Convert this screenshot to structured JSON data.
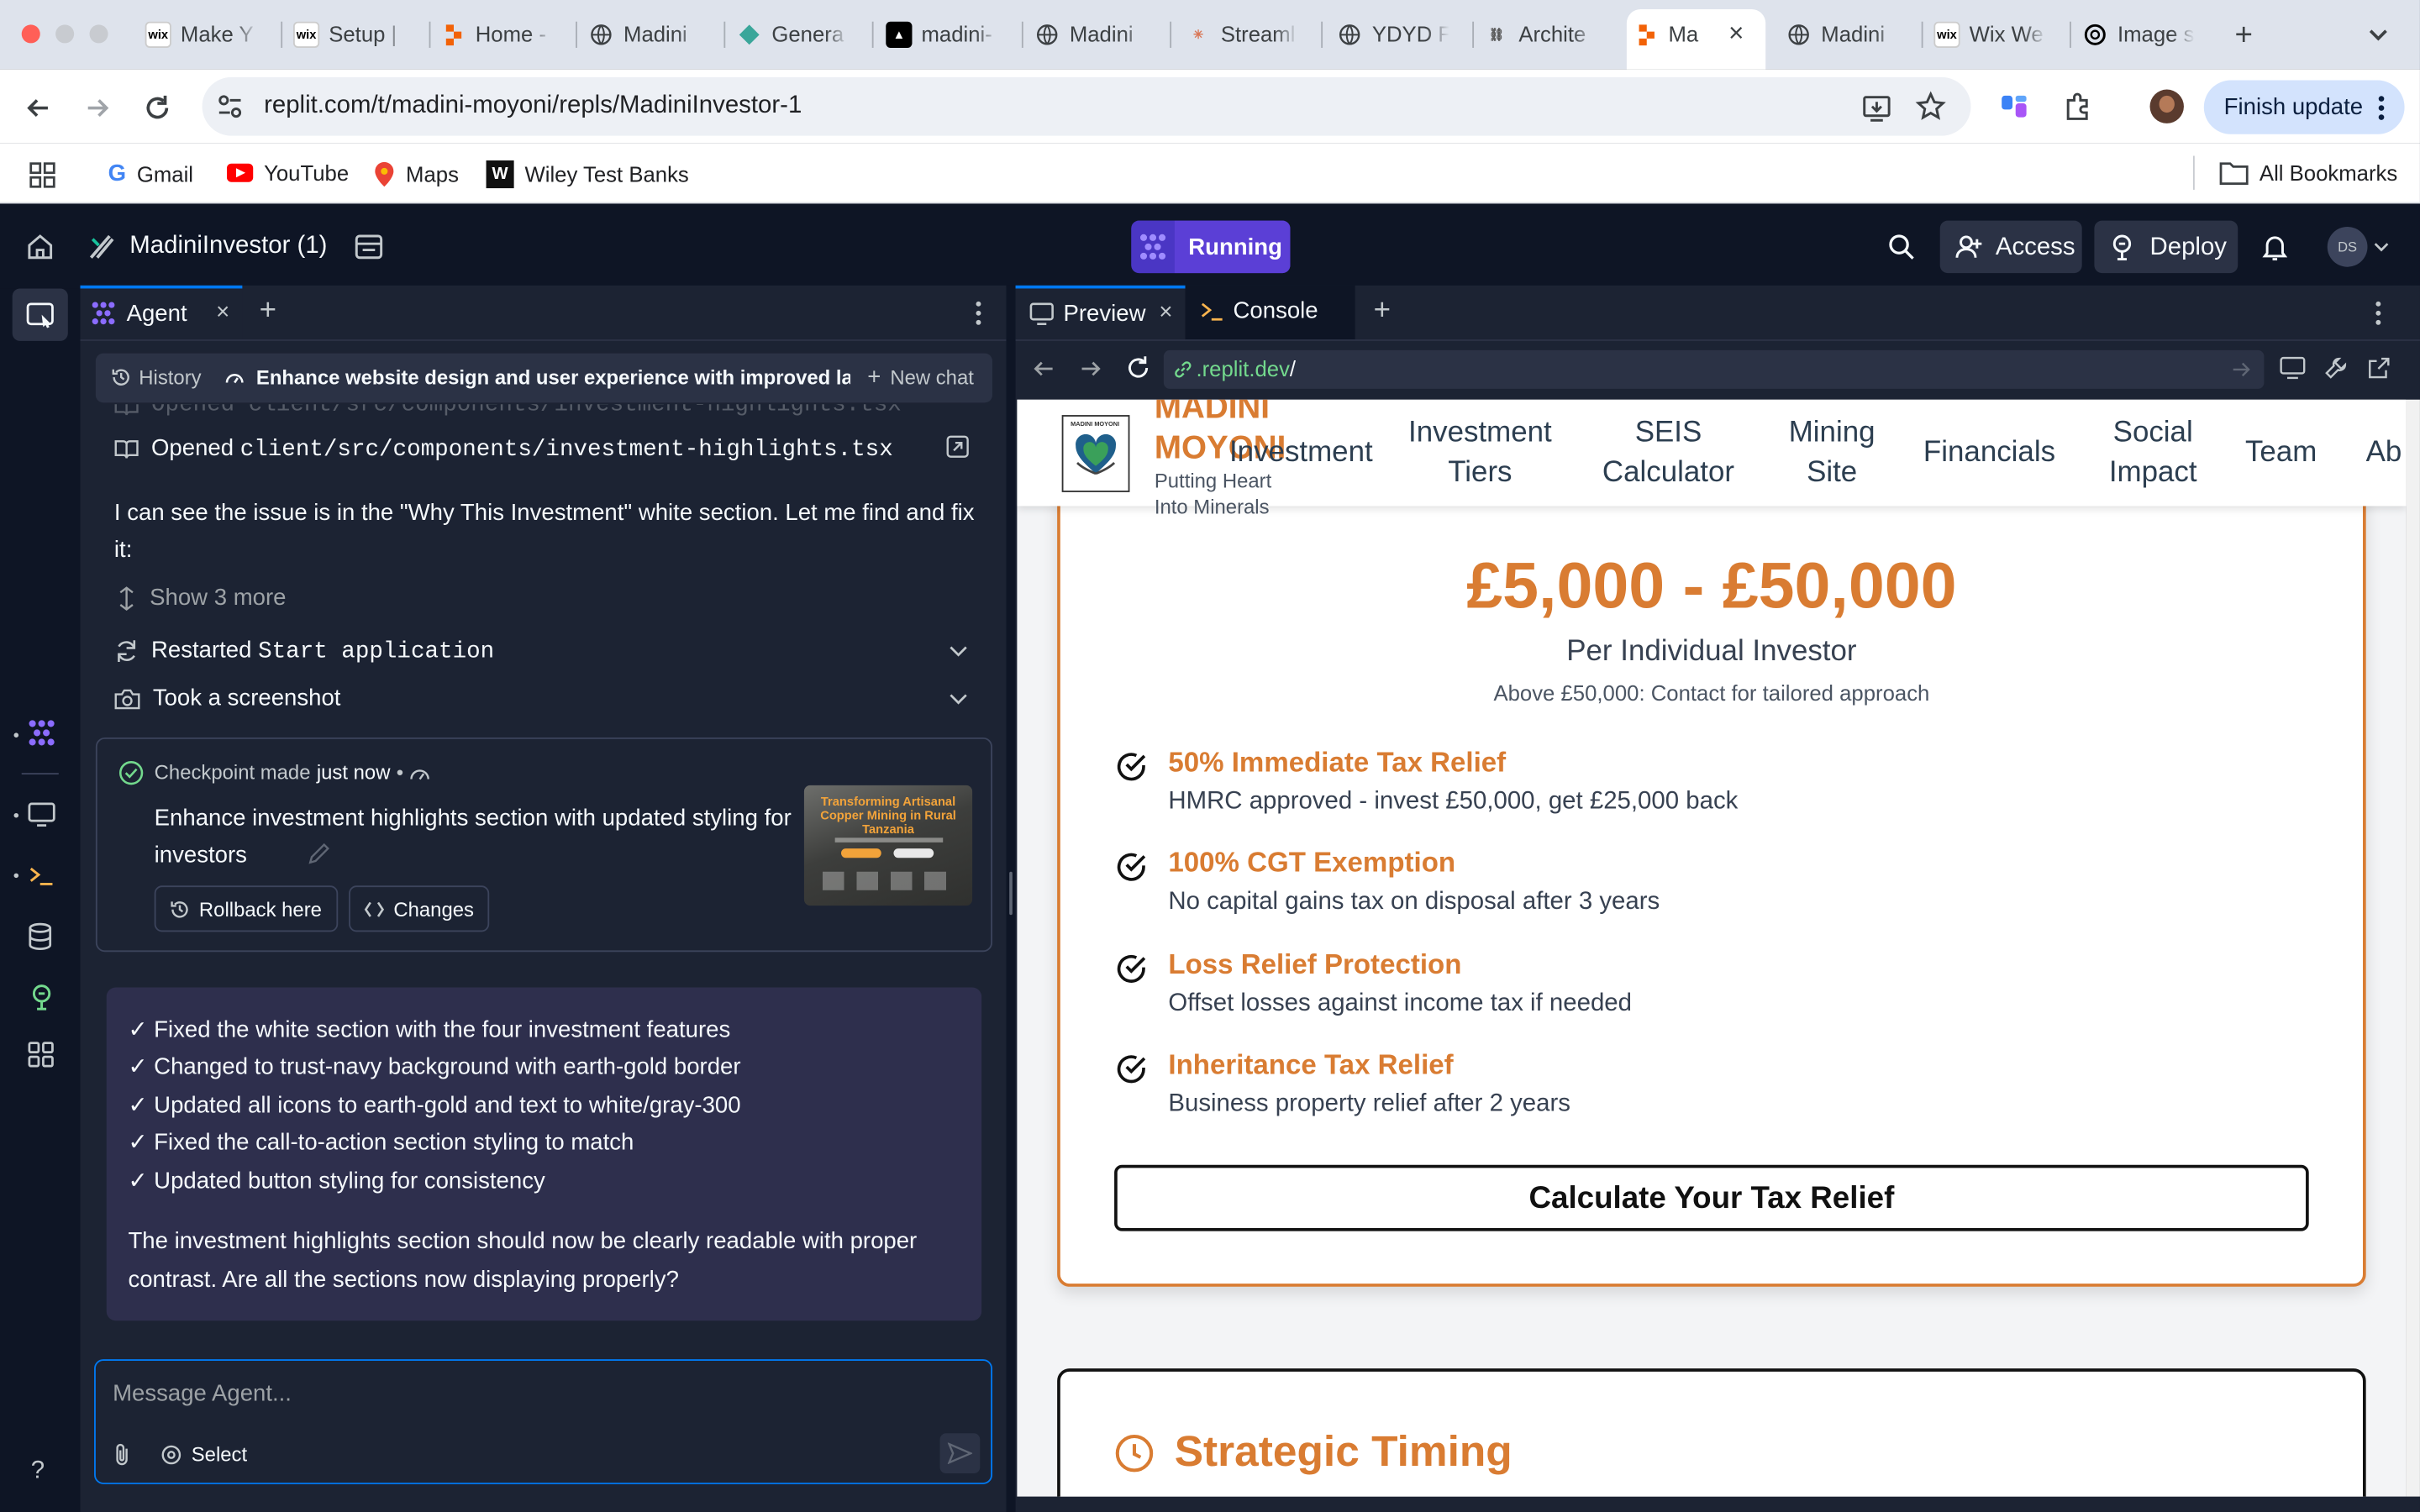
{
  "browser": {
    "tabs": [
      {
        "label": "Make Y",
        "icon": "wix-icon"
      },
      {
        "label": "Setup |",
        "icon": "wix-icon"
      },
      {
        "label": "Home -",
        "icon": "replit-icon"
      },
      {
        "label": "Madini",
        "icon": "globe-icon"
      },
      {
        "label": "Genera",
        "icon": "diamond-icon"
      },
      {
        "label": "madini-",
        "icon": "vercel-icon"
      },
      {
        "label": "Madini",
        "icon": "globe-icon"
      },
      {
        "label": "Streaml",
        "icon": "claude-icon"
      },
      {
        "label": "YDYD F",
        "icon": "globe-icon"
      },
      {
        "label": "Archite",
        "icon": "link-icon"
      },
      {
        "label": "Ma",
        "icon": "replit-icon",
        "active": true
      },
      {
        "label": "Madini",
        "icon": "globe-icon"
      },
      {
        "label": "Wix We",
        "icon": "wix-icon"
      },
      {
        "label": "Image s",
        "icon": "openai-icon"
      }
    ],
    "url": "replit.com/t/madini-moyoni/repls/MadiniInvestor-1",
    "finish_update": "Finish update",
    "bookmarks": [
      "Gmail",
      "YouTube",
      "Maps",
      "Wiley Test Banks"
    ],
    "all_bookmarks": "All Bookmarks"
  },
  "replit": {
    "project_name": "MadiniInvestor (1)",
    "status": "Running",
    "access": "Access",
    "deploy": "Deploy",
    "avatar": "DS"
  },
  "agent": {
    "tab_label": "Agent",
    "history": "History",
    "chat_title": "Enhance website design and user experience with improved la...",
    "new_chat": "New chat",
    "opened_prev": "Opened client/src/components/investment-highlights.tsx",
    "opened_prefix": "Opened ",
    "opened_path": "client/src/components/investment-highlights.tsx",
    "message1": "I can see the issue is in the \"Why This Investment\" white section. Let me find and fix it:",
    "show_more": "Show 3 more",
    "restarted_prefix": "Restarted ",
    "restarted_name": "Start application",
    "screenshot": "Took a screenshot",
    "checkpoint_prefix": "Checkpoint made",
    "checkpoint_time": "just now",
    "checkpoint_sep": "•",
    "checkpoint_title": "Enhance investment highlights section with updated styling for investors",
    "thumb_title": "Transforming Artisanal Copper Mining in Rural Tanzania",
    "rollback": "Rollback here",
    "changes": "Changes",
    "bullets": [
      "✓ Fixed the white section with the four investment features",
      "✓ Changed to trust-navy background with earth-gold border",
      "✓ Updated all icons to earth-gold and text to white/gray-300",
      "✓ Fixed the call-to-action section styling to match",
      "✓ Updated button styling for consistency"
    ],
    "summary": "The investment highlights section should now be clearly readable with proper contrast. Are all the sections now displaying properly?",
    "input_placeholder": "Message Agent...",
    "select": "Select"
  },
  "preview": {
    "tab_preview": "Preview",
    "tab_console": "Console",
    "url_domain": ".replit.dev",
    "url_path": "/"
  },
  "site": {
    "brand_top": "MADINI",
    "brand_bottom": "MOYONI",
    "tagline_1": "Putting Heart",
    "tagline_2": "Into Minerals",
    "logo_text": "MADINI MOYONI",
    "nav": [
      "Investment",
      "Investment\nTiers",
      "SEIS\nCalculator",
      "Mining\nSite",
      "Financials",
      "Social\nImpact",
      "Team",
      "Ab"
    ],
    "amount": "£5,000 - £50,000",
    "per": "Per Individual Investor",
    "above": "Above £50,000: Contact for tailored approach",
    "benefits": [
      {
        "title": "50% Immediate Tax Relief",
        "desc": "HMRC approved - invest £50,000, get £25,000 back"
      },
      {
        "title": "100% CGT Exemption",
        "desc": "No capital gains tax on disposal after 3 years"
      },
      {
        "title": "Loss Relief Protection",
        "desc": "Offset losses against income tax if needed"
      },
      {
        "title": "Inheritance Tax Relief",
        "desc": "Business property relief after 2 years"
      }
    ],
    "cta": "Calculate Your Tax Relief",
    "strategic": "Strategic Timing"
  },
  "colors": {
    "accent_orange": "#d97c32",
    "replit_purple": "#5b3fd6",
    "dark_bg": "#0e1525",
    "panel_bg": "#1c2333"
  }
}
